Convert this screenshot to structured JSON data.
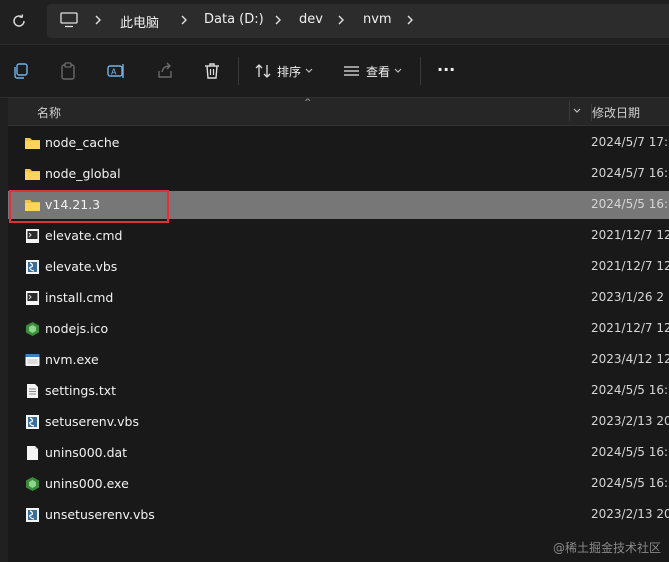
{
  "address_bar": {
    "crumbs": [
      "此电脑",
      "Data (D:)",
      "dev",
      "nvm"
    ]
  },
  "toolbar": {
    "sort_label": "排序",
    "view_label": "查看",
    "more_label": "···"
  },
  "columns": {
    "name": "名称",
    "date": "修改日期"
  },
  "files": [
    {
      "name": "node_cache",
      "date": "2024/5/7 17:",
      "icon": "folder-icon"
    },
    {
      "name": "node_global",
      "date": "2024/5/7 16:",
      "icon": "folder-icon"
    },
    {
      "name": "v14.21.3",
      "date": "2024/5/5 16:",
      "icon": "folder-icon",
      "selected": true
    },
    {
      "name": "elevate.cmd",
      "date": "2021/12/7 12",
      "icon": "cmd-file-icon"
    },
    {
      "name": "elevate.vbs",
      "date": "2021/12/7 12",
      "icon": "vbs-file-icon"
    },
    {
      "name": "install.cmd",
      "date": "2023/1/26 2",
      "icon": "cmd-file-icon"
    },
    {
      "name": "nodejs.ico",
      "date": "2021/12/7 12",
      "icon": "node-hex-icon"
    },
    {
      "name": "nvm.exe",
      "date": "2023/4/12 12",
      "icon": "exe-file-icon"
    },
    {
      "name": "settings.txt",
      "date": "2024/5/5 16:",
      "icon": "text-file-icon"
    },
    {
      "name": "setuserenv.vbs",
      "date": "2023/2/13 20",
      "icon": "vbs-file-icon"
    },
    {
      "name": "unins000.dat",
      "date": "2024/5/5 16:",
      "icon": "blank-file-icon"
    },
    {
      "name": "unins000.exe",
      "date": "2024/5/5 16:",
      "icon": "node-hex-icon"
    },
    {
      "name": "unsetuserenv.vbs",
      "date": "2023/2/13 20",
      "icon": "vbs-file-icon"
    }
  ],
  "watermark": "@稀土掘金技术社区",
  "colors": {
    "folder": "#f5c443",
    "selection": "#777777",
    "highlight_box": "#e0303a",
    "background": "#191919"
  }
}
